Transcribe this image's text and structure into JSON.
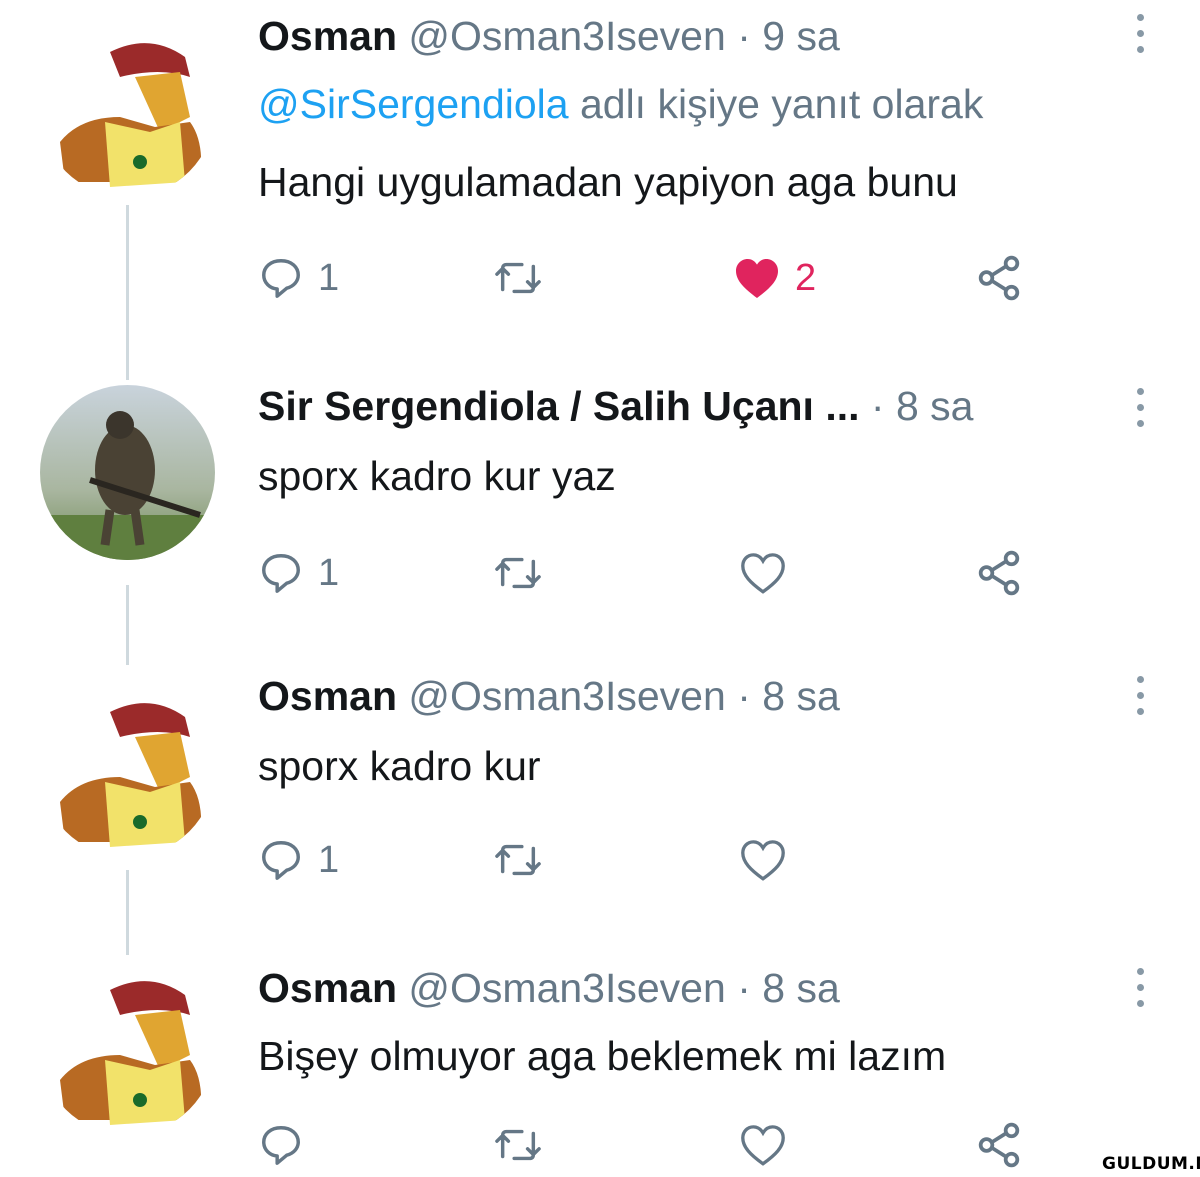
{
  "tweets": [
    {
      "avatar": "cartoon-beret-avatar-icon",
      "name": "Osman",
      "handle": "@Osman3Iseven",
      "dot": "·",
      "time": "9 sa",
      "reply_to": {
        "mention": "@SirSergendiola",
        "suffix": " adlı kişiye yanıt olarak"
      },
      "text": "Hangi uygulamadan yapiyon aga bunu",
      "reply_count": "1",
      "like_count": "2",
      "liked": true
    },
    {
      "avatar": "soldier-photo-avatar-icon",
      "name": "Sir Sergendiola / Salih Uçanı ...",
      "dot": "·",
      "time": "8 sa",
      "text": "sporx kadro kur yaz",
      "reply_count": "1",
      "liked": false
    },
    {
      "avatar": "cartoon-beret-avatar-icon",
      "name": "Osman",
      "handle": "@Osman3Iseven",
      "dot": "·",
      "time": "8 sa",
      "text": "sporx kadro kur",
      "reply_count": "1",
      "liked": false
    },
    {
      "avatar": "cartoon-beret-avatar-icon",
      "name": "Osman",
      "handle": "@Osman3Iseven",
      "dot": "·",
      "time": "8 sa",
      "text": "Bişey olmuyor aga beklemek mi lazım",
      "liked": false
    }
  ],
  "colors": {
    "like": "#e0245e",
    "mention": "#1da1f2",
    "muted": "#657786",
    "thread_line": "#cfd9de"
  },
  "watermark": "GULDUM.NET"
}
